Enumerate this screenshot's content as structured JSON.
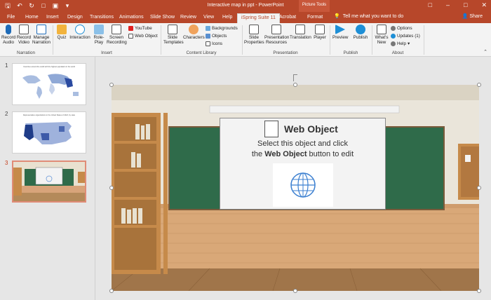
{
  "window": {
    "title": "Interactive map in ppt - PowerPoint",
    "picture_tools": "Picture Tools"
  },
  "tabs": [
    "File",
    "Home",
    "Insert",
    "Design",
    "Transitions",
    "Animations",
    "Slide Show",
    "Review",
    "View",
    "Help",
    "iSpring Suite 11",
    "Acrobat",
    "Format"
  ],
  "active_tab": "iSpring Suite 11",
  "tell_me": "Tell me what you want to do",
  "share": "Share",
  "ribbon": {
    "narration": {
      "label": "Narration",
      "record_audio": "Record Audio",
      "record_video": "Record Video",
      "manage_narration": "Manage Narration"
    },
    "insert": {
      "label": "Insert",
      "quiz": "Quiz",
      "interaction": "Interaction",
      "role_play": "Role-Play",
      "screen_recording": "Screen Recording",
      "youtube": "YouTube",
      "web_object": "Web Object"
    },
    "content_library": {
      "label": "Content Library",
      "slide_templates": "Slide Templates",
      "characters": "Characters",
      "backgrounds": "Backgrounds",
      "objects": "Objects",
      "icons": "Icons"
    },
    "presentation": {
      "label": "Presentation",
      "slide_properties": "Slide Properties",
      "presentation_resources": "Presentation Resources",
      "translation": "Translation",
      "player": "Player"
    },
    "publish": {
      "label": "Publish",
      "preview": "Preview",
      "publish": "Publish"
    },
    "about": {
      "label": "About",
      "whats_new": "What's New",
      "options": "Options",
      "updates": "Updates (1)",
      "help": "Help"
    }
  },
  "slides": [
    {
      "num": "1",
      "caption": "Countries around the world with the highest population in the world"
    },
    {
      "num": "2",
      "caption": "Representative organizations in the United States of 2022, by state"
    },
    {
      "num": "3",
      "caption": ""
    }
  ],
  "selected_slide": "3",
  "web_object": {
    "title": "Web Object",
    "line1": "Select this object and click",
    "line2_pre": "the ",
    "line2_bold": "Web Object",
    "line2_post": " button to edit"
  }
}
